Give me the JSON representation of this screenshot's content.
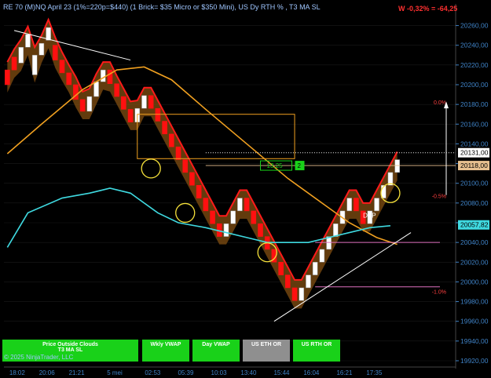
{
  "header": {
    "title": "RE 70 (M)NQ April 23 (1%=220p=$440) (1 Brick= $35 Micro or $350 Mini), US Dy RTH % , T3 MA SL",
    "pnl": "W -0,32% = -64,25"
  },
  "footer": {
    "copyright": "© 2025 NinjaTrader, LLC",
    "buttons": [
      {
        "label": "Price Outside Clouds",
        "color": "#19d119"
      },
      {
        "label": "T3 MA SL",
        "color": "#19d119"
      },
      {
        "label": "Wkly VWAP",
        "color": "#19d119"
      },
      {
        "label": "Day VWAP",
        "color": "#19d119"
      },
      {
        "label": "US ETH OR",
        "color": "#8f8f8f"
      },
      {
        "label": "US RTH OR",
        "color": "#19d119"
      }
    ]
  },
  "chart_data": {
    "type": "renko",
    "y_axis": {
      "min": 19920,
      "max": 20270,
      "ticks": [
        20260,
        20240,
        20220,
        20200,
        20180,
        20160,
        20140,
        20120,
        20100,
        20080,
        20060,
        20040,
        20020,
        20000,
        19980,
        19960,
        19940,
        19920
      ],
      "tick_labels": [
        "20260,00",
        "20240,00",
        "20220,00",
        "20200,00",
        "20180,00",
        "20160,00",
        "20140,00",
        "20120,00",
        "20100,00",
        "20080,00",
        "20060,00",
        "20040,00",
        "20020,00",
        "20000,00",
        "19980,00",
        "19960,00",
        "19940,00",
        "19920,00"
      ]
    },
    "x_axis": {
      "min": 0,
      "max": 100,
      "ticks": [
        {
          "x": 4,
          "label": "18:02"
        },
        {
          "x": 13,
          "label": "20:06"
        },
        {
          "x": 22,
          "label": "21:21"
        },
        {
          "x": 33.5,
          "label": "5 mei"
        },
        {
          "x": 45,
          "label": "02:53"
        },
        {
          "x": 55,
          "label": "05:39"
        },
        {
          "x": 65,
          "label": "10:03"
        },
        {
          "x": 74,
          "label": "13:40"
        },
        {
          "x": 84,
          "label": "15:44"
        },
        {
          "x": 93,
          "label": "16:04"
        },
        {
          "x": 103,
          "label": "16:21"
        },
        {
          "x": 112,
          "label": "17:35"
        }
      ]
    },
    "bricks": [
      {
        "x": 1,
        "open": 20215,
        "close": 20200
      },
      {
        "x": 2,
        "open": 20228,
        "close": 20215
      },
      {
        "x": 3,
        "open": 20222,
        "close": 20238
      },
      {
        "x": 4,
        "open": 20238,
        "close": 20251
      },
      {
        "x": 5,
        "open": 20210,
        "close": 20230
      },
      {
        "x": 6,
        "open": 20230,
        "close": 20242
      },
      {
        "x": 7,
        "open": 20245,
        "close": 20258
      },
      {
        "x": 8,
        "open": 20240,
        "close": 20225
      },
      {
        "x": 9,
        "open": 20225,
        "close": 20212
      },
      {
        "x": 10,
        "open": 20212,
        "close": 20200
      },
      {
        "x": 11,
        "open": 20200,
        "close": 20185
      },
      {
        "x": 12,
        "open": 20185,
        "close": 20173
      },
      {
        "x": 13,
        "open": 20173,
        "close": 20188
      },
      {
        "x": 14,
        "open": 20188,
        "close": 20203
      },
      {
        "x": 15,
        "open": 20203,
        "close": 20215
      },
      {
        "x": 16,
        "open": 20215,
        "close": 20201
      },
      {
        "x": 17,
        "open": 20201,
        "close": 20188
      },
      {
        "x": 18,
        "open": 20188,
        "close": 20175
      },
      {
        "x": 19,
        "open": 20175,
        "close": 20162
      },
      {
        "x": 20,
        "open": 20162,
        "close": 20176
      },
      {
        "x": 21,
        "open": 20176,
        "close": 20189
      },
      {
        "x": 22,
        "open": 20189,
        "close": 20176
      },
      {
        "x": 23,
        "open": 20176,
        "close": 20163
      },
      {
        "x": 24,
        "open": 20163,
        "close": 20150
      },
      {
        "x": 25,
        "open": 20150,
        "close": 20137
      },
      {
        "x": 26,
        "open": 20137,
        "close": 20124
      },
      {
        "x": 27,
        "open": 20124,
        "close": 20111
      },
      {
        "x": 28,
        "open": 20111,
        "close": 20098
      },
      {
        "x": 29,
        "open": 20098,
        "close": 20085
      },
      {
        "x": 30,
        "open": 20085,
        "close": 20072
      },
      {
        "x": 31,
        "open": 20072,
        "close": 20059
      },
      {
        "x": 32,
        "open": 20059,
        "close": 20046
      },
      {
        "x": 33,
        "open": 20046,
        "close": 20059
      },
      {
        "x": 34,
        "open": 20059,
        "close": 20072
      },
      {
        "x": 35,
        "open": 20072,
        "close": 20085
      },
      {
        "x": 36,
        "open": 20085,
        "close": 20072
      },
      {
        "x": 37,
        "open": 20072,
        "close": 20059
      },
      {
        "x": 38,
        "open": 20059,
        "close": 20046
      },
      {
        "x": 39,
        "open": 20046,
        "close": 20033
      },
      {
        "x": 40,
        "open": 20033,
        "close": 20020
      },
      {
        "x": 41,
        "open": 20020,
        "close": 20007
      },
      {
        "x": 42,
        "open": 20007,
        "close": 19994
      },
      {
        "x": 43,
        "open": 19994,
        "close": 19981
      },
      {
        "x": 44,
        "open": 19981,
        "close": 19994
      },
      {
        "x": 45,
        "open": 19994,
        "close": 20007
      },
      {
        "x": 46,
        "open": 20007,
        "close": 20020
      },
      {
        "x": 47,
        "open": 20020,
        "close": 20033
      },
      {
        "x": 48,
        "open": 20033,
        "close": 20046
      },
      {
        "x": 49,
        "open": 20046,
        "close": 20059
      },
      {
        "x": 50,
        "open": 20059,
        "close": 20072
      },
      {
        "x": 51,
        "open": 20072,
        "close": 20085
      },
      {
        "x": 52,
        "open": 20085,
        "close": 20072
      },
      {
        "x": 53,
        "open": 20072,
        "close": 20059
      },
      {
        "x": 54,
        "open": 20059,
        "close": 20072
      },
      {
        "x": 55,
        "open": 20072,
        "close": 20085
      },
      {
        "x": 56,
        "open": 20085,
        "close": 20098
      },
      {
        "x": 57,
        "open": 20098,
        "close": 20111
      },
      {
        "x": 58,
        "open": 20111,
        "close": 20124
      }
    ],
    "series": [
      {
        "name": "T3 MA",
        "color": "#f0a020",
        "points": [
          [
            1,
            20130
          ],
          [
            6,
            20160
          ],
          [
            12,
            20195
          ],
          [
            17,
            20215
          ],
          [
            21,
            20218
          ],
          [
            25,
            20205
          ],
          [
            30,
            20175
          ],
          [
            36,
            20140
          ],
          [
            42,
            20105
          ],
          [
            47,
            20080
          ],
          [
            51,
            20060
          ],
          [
            55,
            20045
          ],
          [
            58,
            20038
          ]
        ]
      },
      {
        "name": "VWAP",
        "color": "#3fd9e0",
        "points": [
          [
            1,
            20035
          ],
          [
            4,
            20070
          ],
          [
            9,
            20085
          ],
          [
            13,
            20090
          ],
          [
            16,
            20095
          ],
          [
            19,
            20090
          ],
          [
            23,
            20070
          ],
          [
            26,
            20060
          ],
          [
            30,
            20055
          ],
          [
            33,
            20050
          ],
          [
            36,
            20045
          ],
          [
            39,
            20040
          ],
          [
            42,
            20040
          ],
          [
            45,
            20040
          ],
          [
            48,
            20045
          ],
          [
            51,
            20050
          ],
          [
            54,
            20055
          ],
          [
            57,
            20057
          ]
        ]
      }
    ],
    "price_labels": [
      {
        "value": 20131.0,
        "label": "20131,00",
        "color": "#ffffff"
      },
      {
        "value": 20118.0,
        "label": "20118,00",
        "color": "#e7c08f"
      },
      {
        "value": 20057.82,
        "label": "20057,82",
        "color": "#3fd9e0"
      }
    ],
    "annotations": [
      {
        "text": "13,25",
        "kind": "box"
      },
      {
        "text": "2",
        "kind": "badge"
      },
      {
        "text": "0.0%",
        "kind": "level"
      },
      {
        "text": "-0.5%",
        "kind": "level"
      },
      {
        "text": "-1.0%",
        "kind": "level"
      },
      {
        "text": "DPP",
        "kind": "label"
      }
    ]
  }
}
